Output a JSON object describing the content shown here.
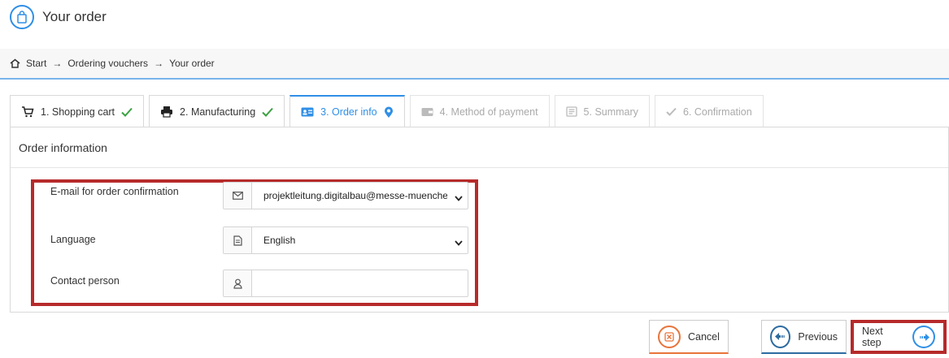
{
  "header": {
    "title": "Your order",
    "icon": "shopping-bag-icon"
  },
  "breadcrumb": {
    "items": [
      "Start",
      "Ordering vouchers",
      "Your order"
    ],
    "separator": "→"
  },
  "tabs": [
    {
      "label": "1. Shopping cart",
      "icon": "cart-icon",
      "state": "completed"
    },
    {
      "label": "2. Manufacturing",
      "icon": "printer-icon",
      "state": "completed"
    },
    {
      "label": "3. Order info",
      "icon": "id-card-icon",
      "state": "active"
    },
    {
      "label": "4. Method of payment",
      "icon": "wallet-icon",
      "state": "disabled"
    },
    {
      "label": "5. Summary",
      "icon": "document-icon",
      "state": "disabled"
    },
    {
      "label": "6. Confirmation",
      "icon": "checkmark-icon",
      "state": "disabled"
    }
  ],
  "panel": {
    "title": "Order information"
  },
  "form": {
    "email_label": "E-mail for order confirmation",
    "email_value": "projektleitung.digitalbau@messe-muenchen.de",
    "language_label": "Language",
    "language_value": "English",
    "contact_label": "Contact person",
    "contact_value": ""
  },
  "buttons": {
    "cancel": "Cancel",
    "previous": "Previous",
    "next": "Next step"
  },
  "colors": {
    "accent": "#2f8fe6",
    "highlight": "#b72a2a",
    "success": "#3aa142",
    "cancel_accent": "#e8743b",
    "previous_accent": "#2d6ba1"
  }
}
